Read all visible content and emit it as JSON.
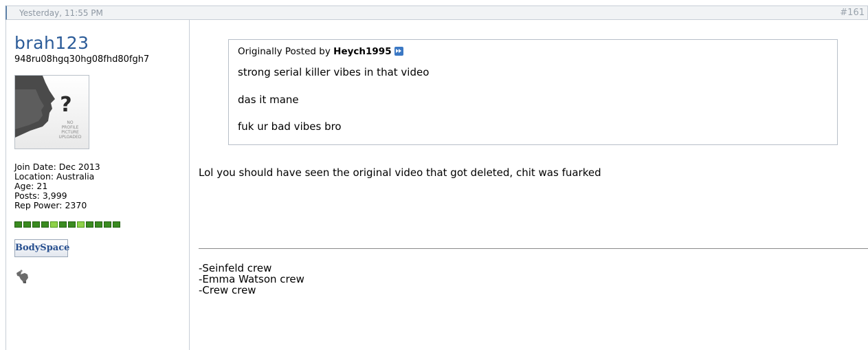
{
  "post": {
    "date": "Yesterday, 11:55 PM",
    "number": "#161"
  },
  "user": {
    "name": "brah123",
    "title": "948ru08hgq30hg08fhd80fgh7",
    "avatar_text": "NO PROFILE PICTURE UPLOADED",
    "join_date": "Join Date: Dec 2013",
    "location": "Location: Australia",
    "age": "Age: 21",
    "posts": "Posts: 3,999",
    "rep_power": "Rep Power: 2370",
    "bodyspace_label": "BodySpace"
  },
  "quote": {
    "prefix": "Originally Posted by",
    "author": "Heych1995",
    "lines": [
      "strong serial killer vibes in that video",
      "das it mane",
      "fuk ur bad vibes bro"
    ]
  },
  "message": "Lol you should have seen the original video that got deleted, chit was fuarked",
  "signature": [
    "-Seinfeld crew",
    "-Emma Watson crew",
    "-Crew crew"
  ],
  "colors": {
    "username": "#2b5b98",
    "rep_pip": "#3a8b20",
    "view_post_icon": "#3b78c4"
  }
}
